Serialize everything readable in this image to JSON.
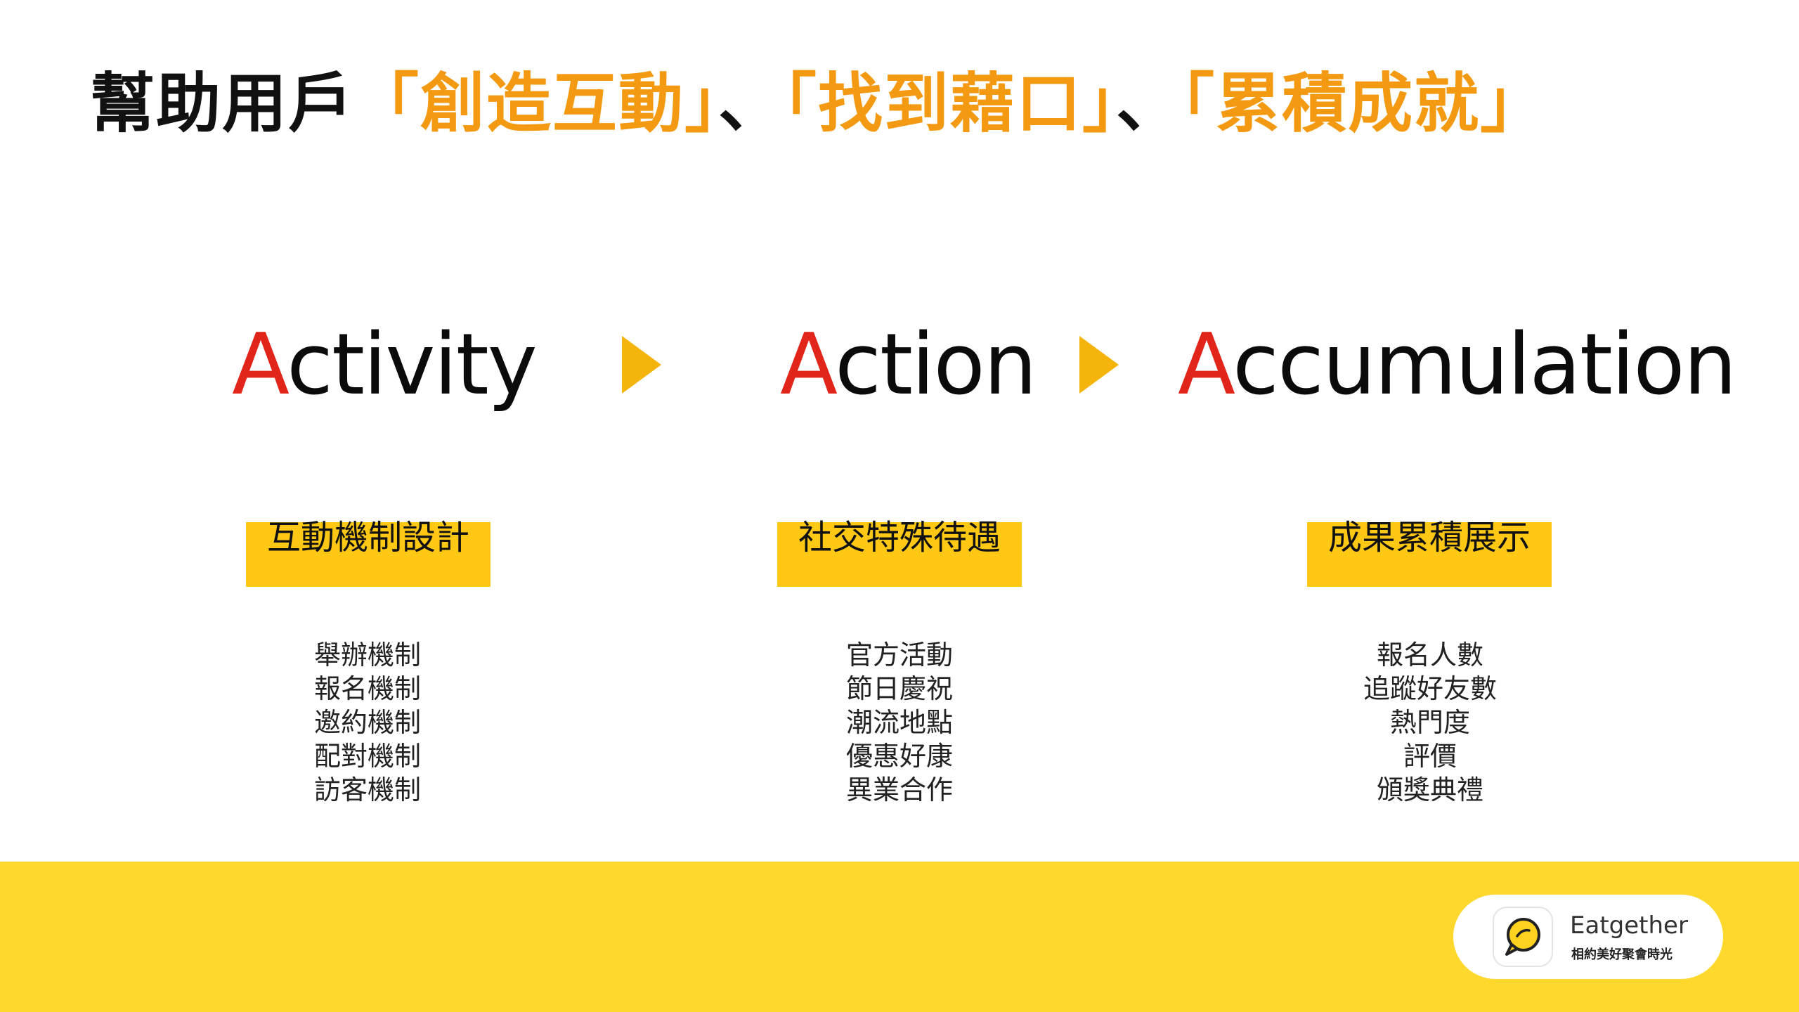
{
  "title": {
    "prefix": "幫助用戶",
    "highlight1": "「創造互動」",
    "sep1": "、",
    "highlight2": "「找到藉口」",
    "sep2": "、",
    "highlight3": "「累積成就」"
  },
  "steps": [
    {
      "cap": "A",
      "rest": "ctivity"
    },
    {
      "cap": "A",
      "rest": "ction"
    },
    {
      "cap": "A",
      "rest": "ccumulation"
    }
  ],
  "categories": [
    {
      "label": "互動機制設計",
      "items": [
        "舉辦機制",
        "報名機制",
        "邀約機制",
        "配對機制",
        "訪客機制"
      ]
    },
    {
      "label": "社交特殊待遇",
      "items": [
        "官方活動",
        "節日慶祝",
        "潮流地點",
        "優惠好康",
        "異業合作"
      ]
    },
    {
      "label": "成果累積展示",
      "items": [
        "報名人數",
        "追蹤好友數",
        "熱門度",
        "評價",
        "頒獎典禮"
      ]
    }
  ],
  "logo": {
    "name": "Eatgether",
    "tagline": "相約美好聚會時光",
    "icon": "chat-bubble-icon"
  },
  "colors": {
    "accent_orange": "#F39A12",
    "letter_red": "#E1251B",
    "arrow": "#F5B40B",
    "highlight_bar": "#FFC815",
    "footer": "#FFD82E"
  }
}
